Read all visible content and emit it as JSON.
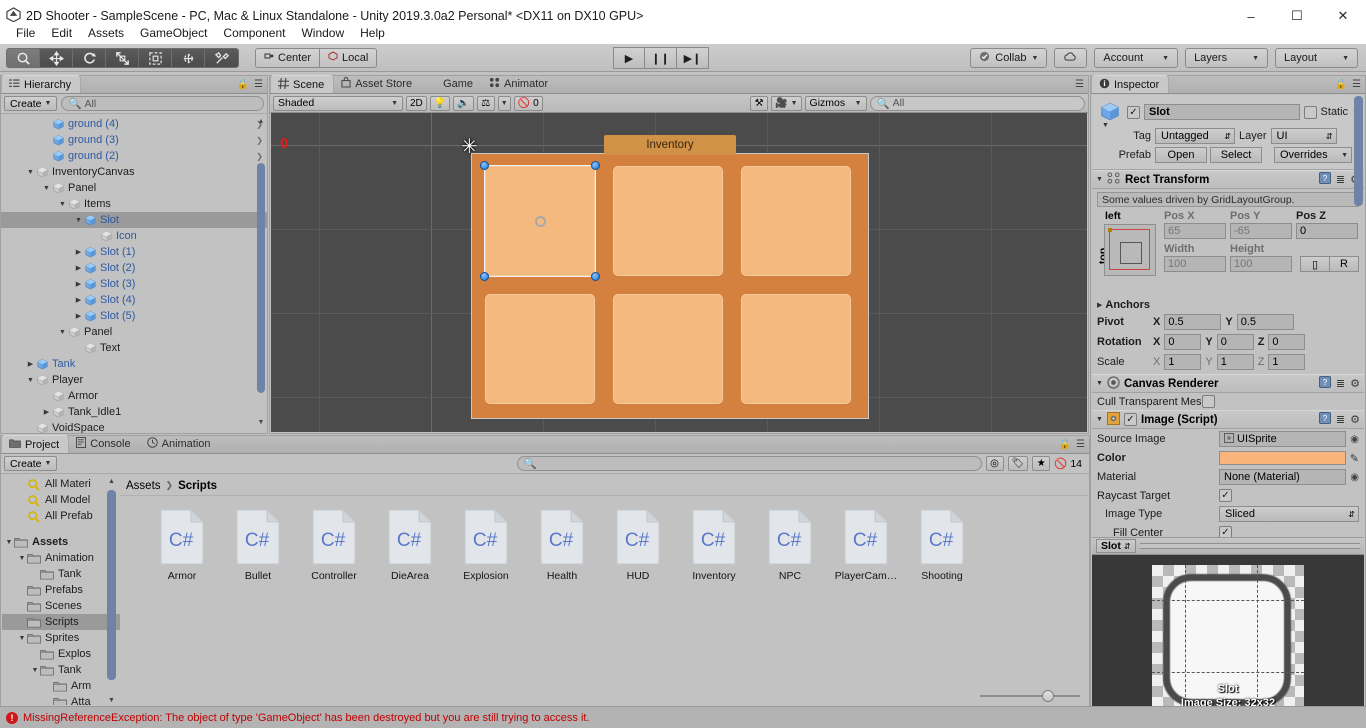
{
  "window": {
    "title": "2D Shooter - SampleScene - PC, Mac & Linux Standalone - Unity 2019.3.0a2 Personal* <DX11 on DX10 GPU>",
    "logo_icon": "unity-logo-icon",
    "minimize": "–",
    "maximize": "☐",
    "close": "✕"
  },
  "menubar": {
    "items": [
      "File",
      "Edit",
      "Assets",
      "GameObject",
      "Component",
      "Window",
      "Help"
    ]
  },
  "toolbar": {
    "tools": [
      {
        "name": "hand-tool",
        "glyph": "✋",
        "active": false
      },
      {
        "name": "move-tool",
        "glyph": "✥",
        "active": false
      },
      {
        "name": "rotate-tool",
        "glyph": "↻",
        "active": false
      },
      {
        "name": "scale-tool",
        "glyph": "⤡",
        "active": false
      },
      {
        "name": "rect-tool",
        "glyph": "▣",
        "active": false
      },
      {
        "name": "transform-tool",
        "glyph": "⊕",
        "active": false
      },
      {
        "name": "custom-tool",
        "glyph": "⚒",
        "active": false
      }
    ],
    "pivot_mode": "Center",
    "pivot_rotation": "Local",
    "play": "▶",
    "pause": "❙❙",
    "step": "▶❙",
    "collab": "Collab",
    "cloud_icon": "cloud-icon",
    "account": "Account",
    "layers": "Layers",
    "layout": "Layout"
  },
  "hierarchy": {
    "tab_label": "Hierarchy",
    "tab_icon": "hierarchy-icon",
    "create_label": "Create",
    "search_placeholder": "All",
    "items": [
      {
        "label": "ground (4)",
        "depth": 2,
        "twirl": "",
        "icon": "prefab-cube",
        "prefab": true,
        "chevron": true,
        "selected": false
      },
      {
        "label": "ground (3)",
        "depth": 2,
        "twirl": "",
        "icon": "prefab-cube",
        "prefab": true,
        "chevron": true,
        "selected": false
      },
      {
        "label": "ground (2)",
        "depth": 2,
        "twirl": "",
        "icon": "prefab-cube",
        "prefab": true,
        "chevron": true,
        "selected": false
      },
      {
        "label": "InventoryCanvas",
        "depth": 1,
        "twirl": "▼",
        "icon": "gameobject-cube",
        "prefab": false,
        "chevron": false,
        "selected": false
      },
      {
        "label": "Panel",
        "depth": 2,
        "twirl": "▼",
        "icon": "gameobject-cube",
        "prefab": false,
        "chevron": false,
        "selected": false
      },
      {
        "label": "Items",
        "depth": 3,
        "twirl": "▼",
        "icon": "gameobject-cube",
        "prefab": false,
        "chevron": false,
        "selected": false
      },
      {
        "label": "Slot",
        "depth": 4,
        "twirl": "▼",
        "icon": "prefab-cube",
        "prefab": true,
        "chevron": true,
        "selected": true
      },
      {
        "label": "Icon",
        "depth": 5,
        "twirl": "",
        "icon": "gameobject-cube",
        "prefab": true,
        "chevron": false,
        "selected": false
      },
      {
        "label": "Slot (1)",
        "depth": 4,
        "twirl": "▶",
        "icon": "prefab-cube",
        "prefab": true,
        "chevron": true,
        "selected": false
      },
      {
        "label": "Slot (2)",
        "depth": 4,
        "twirl": "▶",
        "icon": "prefab-cube",
        "prefab": true,
        "chevron": true,
        "selected": false
      },
      {
        "label": "Slot (3)",
        "depth": 4,
        "twirl": "▶",
        "icon": "prefab-cube",
        "prefab": true,
        "chevron": true,
        "selected": false
      },
      {
        "label": "Slot (4)",
        "depth": 4,
        "twirl": "▶",
        "icon": "prefab-cube",
        "prefab": true,
        "chevron": true,
        "selected": false
      },
      {
        "label": "Slot (5)",
        "depth": 4,
        "twirl": "▶",
        "icon": "prefab-cube",
        "prefab": true,
        "chevron": true,
        "selected": false
      },
      {
        "label": "Panel",
        "depth": 3,
        "twirl": "▼",
        "icon": "gameobject-cube",
        "prefab": false,
        "chevron": false,
        "selected": false
      },
      {
        "label": "Text",
        "depth": 4,
        "twirl": "",
        "icon": "gameobject-cube",
        "prefab": false,
        "chevron": false,
        "selected": false
      },
      {
        "label": "Tank",
        "depth": 1,
        "twirl": "▶",
        "icon": "prefab-cube",
        "prefab": true,
        "chevron": true,
        "selected": false
      },
      {
        "label": "Player",
        "depth": 1,
        "twirl": "▼",
        "icon": "gameobject-cube",
        "prefab": false,
        "chevron": false,
        "selected": false
      },
      {
        "label": "Armor",
        "depth": 2,
        "twirl": "",
        "icon": "gameobject-cube",
        "prefab": false,
        "chevron": false,
        "selected": false
      },
      {
        "label": "Tank_Idle1",
        "depth": 2,
        "twirl": "▶",
        "icon": "gameobject-cube",
        "prefab": false,
        "chevron": false,
        "selected": false
      },
      {
        "label": "VoidSpace",
        "depth": 1,
        "twirl": "",
        "icon": "gameobject-cube",
        "prefab": false,
        "chevron": false,
        "selected": false
      }
    ]
  },
  "scene": {
    "tabs": [
      {
        "label": "Scene",
        "icon": "scene-icon",
        "active": true
      },
      {
        "label": "Asset Store",
        "icon": "store-icon",
        "active": false
      },
      {
        "label": "Game",
        "icon": "game-icon",
        "active": false
      },
      {
        "label": "Animator",
        "icon": "animator-icon",
        "active": false
      }
    ],
    "shading_mode": "Shaded",
    "mode_2d": "2D",
    "lighting_icon": "lighting-icon",
    "audio_icon": "audio-icon",
    "fx_icon": "fx-icon",
    "hidden_count": "0",
    "hidden_icon": "eye-off-icon",
    "tools_icon": "scene-tools-icon",
    "camera_icon": "scene-camera-icon",
    "gizmos_label": "Gizmos",
    "search_placeholder": "All",
    "origin_marker": "0",
    "inventory": {
      "title": "Inventory",
      "panel_color": "#d4803f",
      "slot_color": "#f4b97e",
      "title_color": "#cf9247",
      "slot_count": 6
    },
    "cursor_icon": "rect-transform-cursor"
  },
  "inspector": {
    "tab_label": "Inspector",
    "tab_icon": "inspector-icon",
    "gameobject": {
      "enabled": true,
      "name": "Slot",
      "static_label": "Static",
      "static_checked": false,
      "tag_label": "Tag",
      "tag_value": "Untagged",
      "layer_label": "Layer",
      "layer_value": "UI",
      "prefab_label": "Prefab",
      "prefab_open": "Open",
      "prefab_select": "Select",
      "prefab_overrides": "Overrides"
    },
    "rect_transform": {
      "title": "Rect Transform",
      "notice": "Some values driven by GridLayoutGroup.",
      "anchor_left": "left",
      "anchor_top": "top",
      "pos_x_label": "Pos X",
      "pos_x": "65",
      "pos_y_label": "Pos Y",
      "pos_y": "-65",
      "pos_z_label": "Pos Z",
      "pos_z": "0",
      "width_label": "Width",
      "width": "100",
      "height_label": "Height",
      "height": "100",
      "blueprint_icon": "blueprint-icon",
      "raw_label": "R",
      "anchors_label": "Anchors",
      "pivot_label": "Pivot",
      "pivot_x": "0.5",
      "pivot_y": "0.5",
      "rotation_label": "Rotation",
      "rot_x": "0",
      "rot_y": "0",
      "rot_z": "0",
      "scale_label": "Scale",
      "scale_x": "1",
      "scale_y": "1",
      "scale_z": "1"
    },
    "canvas_renderer": {
      "title": "Canvas Renderer",
      "cull_label": "Cull Transparent Mes",
      "cull_checked": false
    },
    "image_script": {
      "title": "Image (Script)",
      "enabled": true,
      "source_image_label": "Source Image",
      "source_image_value": "UISprite",
      "color_label": "Color",
      "color_value": "#f9b47c",
      "material_label": "Material",
      "material_value": "None (Material)",
      "raycast_label": "Raycast Target",
      "raycast_checked": true,
      "image_type_label": "Image Type",
      "image_type_value": "Sliced",
      "fill_center_label": "Fill Center",
      "fill_center_checked": true,
      "eyedropper_icon": "eyedropper-icon"
    },
    "preview": {
      "name": "Slot",
      "overlay_name": "Slot",
      "overlay_size": "Image Size: 32x32"
    }
  },
  "project": {
    "tabs": [
      {
        "label": "Project",
        "icon": "project-icon",
        "active": true
      },
      {
        "label": "Console",
        "icon": "console-icon",
        "active": false
      },
      {
        "label": "Animation",
        "icon": "animation-icon",
        "active": false
      }
    ],
    "create_label": "Create",
    "search_placeholder": "",
    "filter_icons": [
      "asset-filter-icon",
      "label-filter-icon",
      "favorite-icon"
    ],
    "hidden_icon": "eye-off-icon",
    "hidden_count": "14",
    "breadcrumb": [
      "Assets",
      "Scripts"
    ],
    "tree": [
      {
        "label": "All Materi",
        "depth": 1,
        "twirl": "",
        "icon": "search-favorite",
        "selected": false
      },
      {
        "label": "All Model",
        "depth": 1,
        "twirl": "",
        "icon": "search-favorite",
        "selected": false
      },
      {
        "label": "All Prefab",
        "depth": 1,
        "twirl": "",
        "icon": "search-favorite",
        "selected": false
      },
      {
        "label": "",
        "depth": 0,
        "twirl": "",
        "icon": "spacer",
        "selected": false
      },
      {
        "label": "Assets",
        "depth": 0,
        "twirl": "▼",
        "icon": "folder",
        "selected": false,
        "bold": true
      },
      {
        "label": "Animation",
        "depth": 1,
        "twirl": "▼",
        "icon": "folder",
        "selected": false
      },
      {
        "label": "Tank",
        "depth": 2,
        "twirl": "",
        "icon": "folder",
        "selected": false
      },
      {
        "label": "Prefabs",
        "depth": 1,
        "twirl": "",
        "icon": "folder",
        "selected": false
      },
      {
        "label": "Scenes",
        "depth": 1,
        "twirl": "",
        "icon": "folder",
        "selected": false
      },
      {
        "label": "Scripts",
        "depth": 1,
        "twirl": "",
        "icon": "folder",
        "selected": true
      },
      {
        "label": "Sprites",
        "depth": 1,
        "twirl": "▼",
        "icon": "folder",
        "selected": false
      },
      {
        "label": "Explos",
        "depth": 2,
        "twirl": "",
        "icon": "folder",
        "selected": false
      },
      {
        "label": "Tank",
        "depth": 2,
        "twirl": "▼",
        "icon": "folder",
        "selected": false
      },
      {
        "label": "Arm",
        "depth": 3,
        "twirl": "",
        "icon": "folder",
        "selected": false
      },
      {
        "label": "Atta",
        "depth": 3,
        "twirl": "",
        "icon": "folder",
        "selected": false
      }
    ],
    "assets": [
      {
        "name": "Armor",
        "type": "csharp"
      },
      {
        "name": "Bullet",
        "type": "csharp"
      },
      {
        "name": "Controller",
        "type": "csharp"
      },
      {
        "name": "DieArea",
        "type": "csharp"
      },
      {
        "name": "Explosion",
        "type": "csharp"
      },
      {
        "name": "Health",
        "type": "csharp"
      },
      {
        "name": "HUD",
        "type": "csharp"
      },
      {
        "name": "Inventory",
        "type": "csharp"
      },
      {
        "name": "NPC",
        "type": "csharp"
      },
      {
        "name": "PlayerCam…",
        "type": "csharp"
      },
      {
        "name": "Shooting",
        "type": "csharp"
      }
    ],
    "csharp_label": "C#"
  },
  "status": {
    "icon": "error-icon",
    "message": "MissingReferenceException: The object of type 'GameObject' has been destroyed but you are still trying to access it.",
    "color": "#c00000"
  }
}
